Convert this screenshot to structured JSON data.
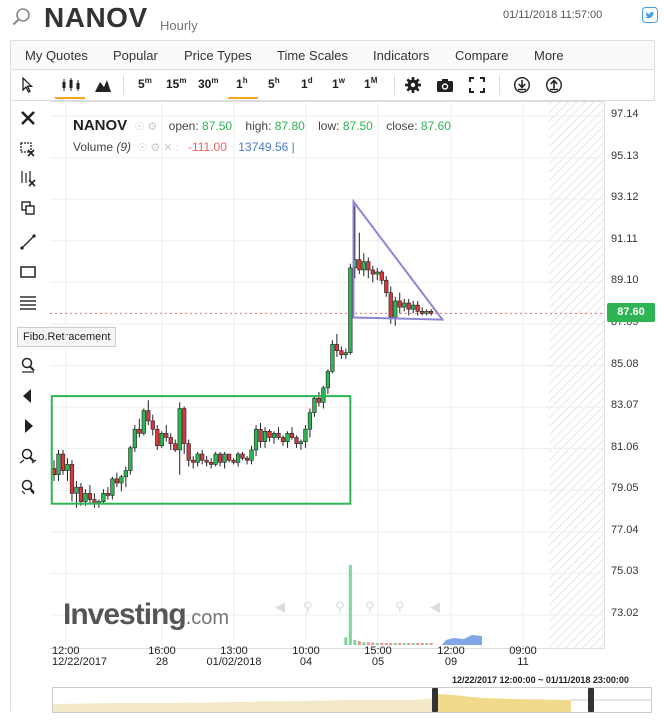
{
  "header": {
    "symbol": "NANOV",
    "interval": "Hourly",
    "datetime": "01/11/2018 11:57:00"
  },
  "menu": [
    "My Quotes",
    "Popular",
    "Price Types",
    "Time Scales",
    "Indicators",
    "Compare",
    "More"
  ],
  "toolbar": {
    "intervals": [
      {
        "num": "5",
        "unit": "m"
      },
      {
        "num": "15",
        "unit": "m"
      },
      {
        "num": "30",
        "unit": "m"
      },
      {
        "num": "1",
        "unit": "h"
      },
      {
        "num": "5",
        "unit": "h"
      },
      {
        "num": "1",
        "unit": "d"
      },
      {
        "num": "1",
        "unit": "w"
      },
      {
        "num": "1",
        "unit": "M"
      }
    ],
    "active_interval": "1h"
  },
  "tooltip": "Fibo.Retracement",
  "legend": {
    "symbol": "NANOV",
    "open_label": "open:",
    "open": "87.50",
    "high_label": "high:",
    "high": "87.80",
    "low_label": "low:",
    "low": "87.50",
    "close_label": "close:",
    "close": "87.60",
    "volume_label": "Volume",
    "volume_period": "(9)",
    "volume_change": "-111.00",
    "volume_value": "13749.56"
  },
  "current_price": "87.60",
  "logo": {
    "main": "Investing",
    "suffix": ".com"
  },
  "navigator_range": "12/22/2017 12:00:00 ~ 01/11/2018 23:00:00",
  "colors": {
    "up": "#2eb553",
    "down": "#d9363e",
    "accent": "#f5a623",
    "drawing": "#8e84d6",
    "rect": "#2eb553"
  },
  "chart_data": {
    "type": "candlestick",
    "y_ticks": [
      "97.14",
      "95.13",
      "93.12",
      "91.11",
      "89.10",
      "87.09",
      "85.08",
      "83.07",
      "81.06",
      "79.05",
      "77.04",
      "75.03",
      "73.02"
    ],
    "x_labels": [
      {
        "time": "12:00",
        "date": "12/22/2017"
      },
      {
        "time": "16:00",
        "date": "28"
      },
      {
        "time": "13:00",
        "date": "01/02/2018"
      },
      {
        "time": "10:00",
        "date": "04"
      },
      {
        "time": "15:00",
        "date": "05"
      },
      {
        "time": "12:00",
        "date": "09"
      },
      {
        "time": "09:00",
        "date": "11"
      }
    ],
    "candles": [
      [
        80.1,
        80.5,
        79.5,
        79.8
      ],
      [
        79.8,
        81.0,
        79.5,
        80.8
      ],
      [
        80.8,
        81.0,
        79.8,
        80.0
      ],
      [
        80.0,
        80.6,
        79.5,
        80.3
      ],
      [
        80.3,
        80.5,
        78.5,
        78.9
      ],
      [
        78.9,
        79.5,
        78.2,
        79.2
      ],
      [
        79.2,
        79.4,
        78.3,
        78.5
      ],
      [
        78.5,
        79.1,
        78.3,
        78.9
      ],
      [
        78.9,
        79.3,
        78.4,
        78.6
      ],
      [
        78.6,
        78.9,
        78.2,
        78.4
      ],
      [
        78.4,
        78.6,
        78.2,
        78.5
      ],
      [
        78.5,
        79.1,
        78.4,
        78.9
      ],
      [
        78.9,
        79.2,
        78.6,
        78.8
      ],
      [
        78.8,
        79.7,
        78.6,
        79.6
      ],
      [
        79.6,
        79.9,
        79.2,
        79.4
      ],
      [
        79.4,
        79.8,
        79.0,
        79.7
      ],
      [
        79.7,
        80.2,
        79.2,
        80.0
      ],
      [
        80.0,
        81.2,
        79.8,
        81.1
      ],
      [
        81.1,
        82.2,
        80.9,
        82.0
      ],
      [
        82.0,
        82.5,
        81.6,
        81.8
      ],
      [
        81.8,
        83.0,
        81.7,
        82.9
      ],
      [
        82.9,
        83.4,
        82.2,
        82.4
      ],
      [
        82.4,
        82.7,
        81.7,
        82.0
      ],
      [
        82.0,
        82.2,
        81.0,
        81.2
      ],
      [
        81.2,
        81.9,
        81.1,
        81.8
      ],
      [
        81.8,
        82.2,
        81.4,
        81.6
      ],
      [
        81.6,
        81.8,
        81.0,
        81.3
      ],
      [
        81.3,
        81.5,
        80.9,
        81.0
      ],
      [
        81.0,
        83.3,
        79.8,
        83.0
      ],
      [
        83.0,
        83.1,
        80.8,
        81.3
      ],
      [
        81.3,
        81.5,
        80.2,
        80.5
      ],
      [
        80.5,
        80.7,
        80.1,
        80.4
      ],
      [
        80.4,
        80.9,
        80.2,
        80.8
      ],
      [
        80.8,
        81.0,
        80.3,
        80.5
      ],
      [
        80.5,
        80.7,
        80.2,
        80.4
      ],
      [
        80.4,
        80.6,
        80.1,
        80.3
      ],
      [
        80.3,
        80.9,
        80.2,
        80.8
      ],
      [
        80.8,
        80.9,
        80.2,
        80.4
      ],
      [
        80.4,
        80.9,
        80.1,
        80.8
      ],
      [
        80.8,
        80.8,
        80.4,
        80.5
      ],
      [
        80.5,
        80.6,
        80.3,
        80.4
      ],
      [
        80.4,
        80.9,
        80.2,
        80.8
      ],
      [
        80.8,
        80.9,
        80.5,
        80.6
      ],
      [
        80.6,
        80.7,
        80.3,
        80.5
      ],
      [
        80.5,
        81.2,
        80.3,
        81.0
      ],
      [
        81.0,
        82.2,
        80.7,
        82.0
      ],
      [
        82.0,
        82.3,
        81.1,
        81.4
      ],
      [
        81.4,
        82.1,
        81.1,
        81.9
      ],
      [
        81.9,
        82.0,
        81.4,
        81.6
      ],
      [
        81.6,
        81.9,
        81.3,
        81.8
      ],
      [
        81.8,
        82.1,
        81.5,
        81.6
      ],
      [
        81.6,
        81.7,
        81.2,
        81.4
      ],
      [
        81.4,
        81.9,
        81.1,
        81.8
      ],
      [
        81.8,
        82.1,
        81.5,
        81.6
      ],
      [
        81.6,
        81.7,
        81.1,
        81.3
      ],
      [
        81.3,
        81.5,
        81.0,
        81.4
      ],
      [
        81.4,
        82.2,
        81.1,
        82.0
      ],
      [
        82.0,
        83.0,
        81.6,
        82.8
      ],
      [
        82.8,
        83.6,
        82.6,
        83.5
      ],
      [
        83.5,
        83.8,
        83.1,
        83.3
      ],
      [
        83.3,
        84.1,
        83.0,
        84.0
      ],
      [
        84.0,
        84.9,
        83.7,
        84.8
      ],
      [
        84.8,
        86.3,
        84.7,
        86.1
      ],
      [
        86.1,
        86.6,
        85.5,
        85.8
      ],
      [
        85.8,
        86.0,
        85.4,
        85.6
      ],
      [
        85.6,
        85.9,
        85.4,
        85.7
      ],
      [
        85.7,
        90.0,
        85.6,
        89.8
      ],
      [
        89.8,
        92.8,
        89.3,
        90.2
      ],
      [
        90.2,
        91.5,
        89.5,
        89.7
      ],
      [
        89.7,
        90.5,
        89.4,
        90.1
      ],
      [
        90.1,
        90.3,
        89.3,
        89.7
      ],
      [
        89.7,
        89.9,
        89.1,
        89.5
      ],
      [
        89.5,
        89.8,
        89.2,
        89.6
      ],
      [
        89.6,
        89.7,
        89.0,
        89.2
      ],
      [
        89.2,
        89.4,
        88.4,
        88.6
      ],
      [
        88.6,
        88.9,
        87.1,
        87.4
      ],
      [
        87.4,
        88.4,
        87.0,
        88.2
      ],
      [
        88.2,
        88.6,
        87.6,
        87.9
      ],
      [
        87.9,
        88.3,
        87.7,
        88.1
      ],
      [
        88.1,
        88.3,
        87.5,
        87.8
      ],
      [
        87.8,
        88.2,
        87.6,
        88.0
      ],
      [
        88.0,
        88.2,
        87.5,
        87.7
      ],
      [
        87.7,
        87.9,
        87.5,
        87.6
      ],
      [
        87.6,
        87.8,
        87.5,
        87.7
      ],
      [
        87.7,
        87.8,
        87.5,
        87.6
      ]
    ],
    "volume": [
      0,
      0,
      0,
      0,
      0,
      0,
      0,
      0,
      0,
      0,
      0,
      0,
      0,
      0,
      0,
      0,
      0,
      0,
      0,
      0,
      0,
      0,
      0,
      0,
      0,
      0,
      0,
      0,
      0,
      0,
      0,
      0,
      0,
      0,
      0,
      0,
      0,
      0,
      0,
      0,
      0,
      0,
      0,
      0,
      0,
      0,
      0,
      0,
      0,
      0,
      0,
      0,
      0,
      0,
      0,
      0,
      0,
      0,
      0,
      0,
      0,
      0,
      0,
      0,
      0,
      6000,
      62000,
      4000,
      3000,
      2200,
      2000,
      1800,
      1500,
      1200,
      1000,
      900,
      800,
      700,
      600,
      500,
      400,
      300,
      250,
      200,
      150
    ],
    "drawings": {
      "rectangle": {
        "x1_index": -0.5,
        "x2_index": 66.0,
        "y_low": 78.4,
        "y_high": 83.6
      },
      "triangle": [
        {
          "index": 66.7,
          "price": 93.0
        },
        {
          "index": 86.5,
          "price": 87.3
        },
        {
          "index": 66.7,
          "price": 87.4
        }
      ]
    }
  }
}
